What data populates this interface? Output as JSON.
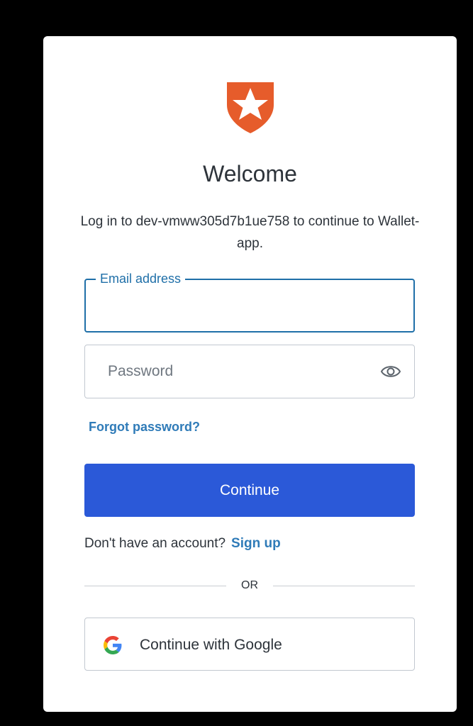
{
  "logo": {
    "icon": "auth0-shield-logo",
    "color": "#e65c2b"
  },
  "heading": "Welcome",
  "subtitle": "Log in to dev-vmww305d7b1ue758 to continue to Wallet-app.",
  "email": {
    "label": "Email address",
    "value": ""
  },
  "password": {
    "placeholder": "Password",
    "toggle_icon": "eye-icon"
  },
  "forgot_password": "Forgot password?",
  "continue_button": "Continue",
  "signup": {
    "prompt": "Don't have an account?",
    "link": "Sign up"
  },
  "divider": "OR",
  "google_button": {
    "label": "Continue with Google",
    "icon": "google-icon"
  },
  "colors": {
    "primary": "#2b59d8",
    "link": "#2f7bb8",
    "focus_border": "#1f6fa8",
    "brand": "#e65c2b"
  }
}
